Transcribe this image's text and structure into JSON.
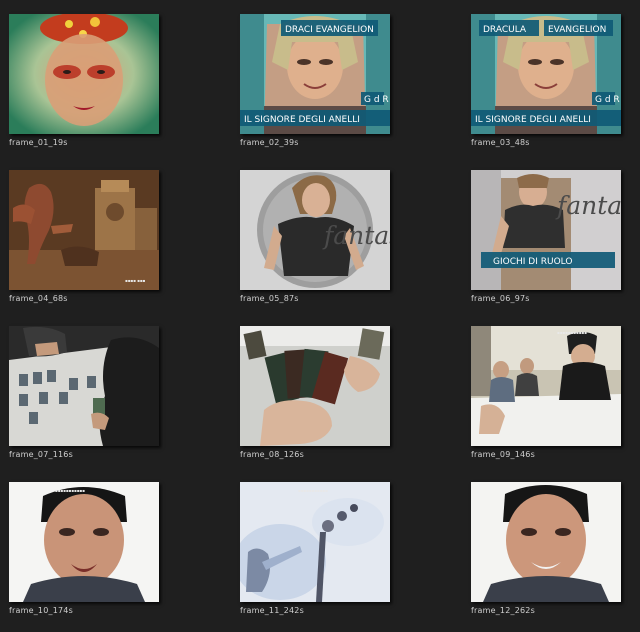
{
  "frames": [
    {
      "caption": "frame_01_19s"
    },
    {
      "caption": "frame_02_39s",
      "overlay_top": "DRACI EVANGELION",
      "overlay_mid": "G d R",
      "overlay_bottom": "IL SIGNORE DEGLI ANELLI"
    },
    {
      "caption": "frame_03_48s",
      "overlay_top_left": "DRACULA",
      "overlay_top_right": "EVANGELION",
      "overlay_mid": "G d R",
      "overlay_bottom": "IL SIGNORE DEGLI ANELLI"
    },
    {
      "caption": "frame_04_68s"
    },
    {
      "caption": "frame_05_87s",
      "overlay_word": "fantasy"
    },
    {
      "caption": "frame_06_97s",
      "overlay_word": "fantasy",
      "overlay_banner": "GIOCHI DI RUOLO"
    },
    {
      "caption": "frame_07_116s"
    },
    {
      "caption": "frame_08_126s"
    },
    {
      "caption": "frame_09_146s"
    },
    {
      "caption": "frame_10_174s"
    },
    {
      "caption": "frame_11_242s"
    },
    {
      "caption": "frame_12_262s"
    }
  ],
  "colors": {
    "page_background": "#1f1f1f",
    "caption_text": "#cfcfcf",
    "overlay_banner": "#0f5a76"
  }
}
